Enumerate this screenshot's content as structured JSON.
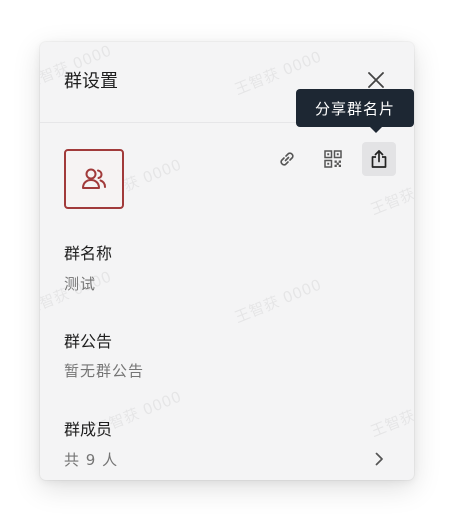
{
  "dialog": {
    "title": "群设置",
    "tooltip": "分享群名片"
  },
  "watermark": {
    "text": "王智获 0000"
  },
  "actions": [
    {
      "name": "link",
      "icon": "link-icon"
    },
    {
      "name": "qrcode",
      "icon": "qrcode-icon"
    },
    {
      "name": "share",
      "icon": "share-icon",
      "active": true
    }
  ],
  "sections": {
    "name": {
      "label": "群名称",
      "value": "测试"
    },
    "notice": {
      "label": "群公告",
      "value": "暂无群公告"
    },
    "members": {
      "label": "群成员",
      "value": "共 9 人"
    }
  },
  "colors": {
    "panel_bg": "#f4f4f5",
    "avatar_accent": "#a13a3a",
    "tooltip_bg": "#1d2733"
  }
}
